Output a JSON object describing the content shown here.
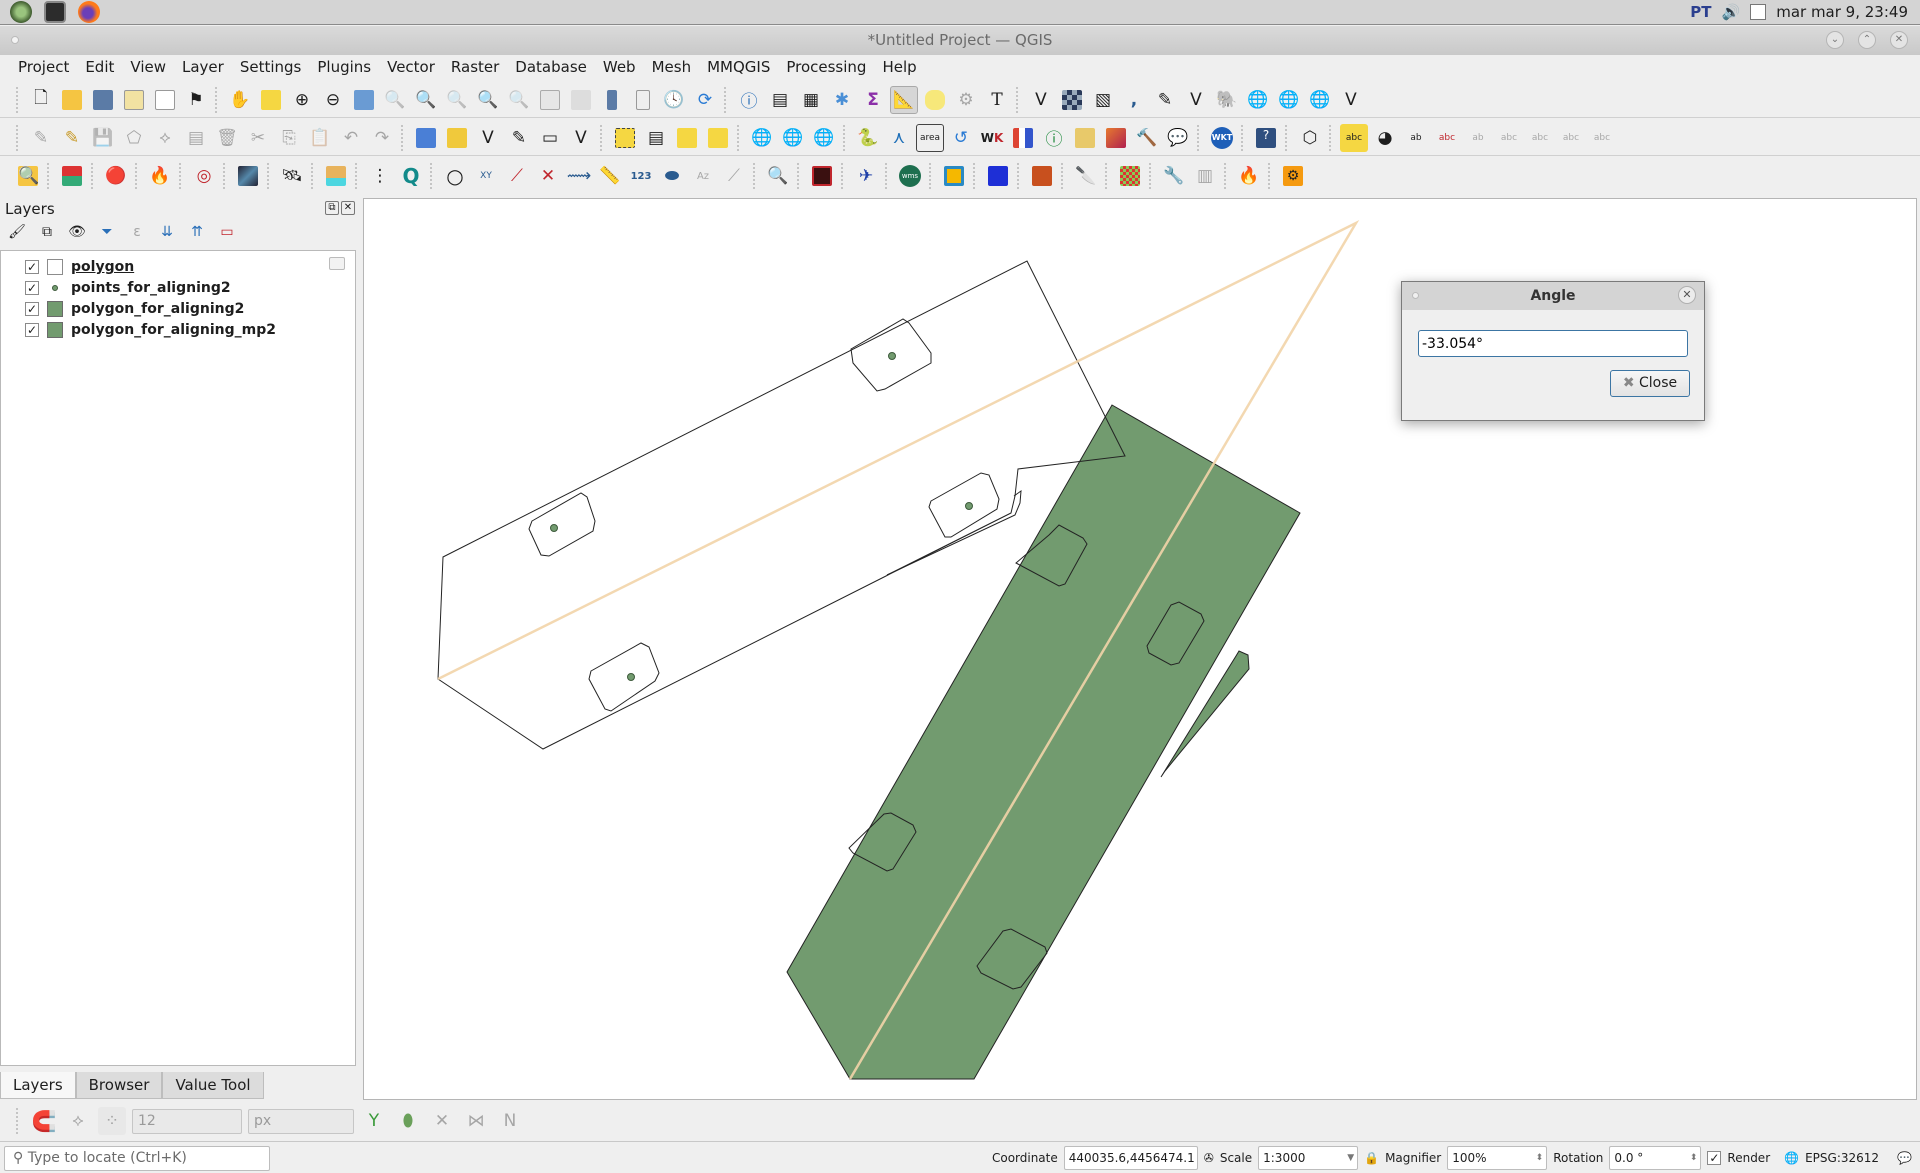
{
  "system_bar": {
    "launchers": [
      "system-launcher",
      "terminal",
      "firefox"
    ],
    "keyboard_layout": "PT",
    "clock": "mar mar  9, 23:49"
  },
  "window": {
    "title": "*Untitled Project — QGIS"
  },
  "menu": [
    "Project",
    "Edit",
    "View",
    "Layer",
    "Settings",
    "Plugins",
    "Vector",
    "Raster",
    "Database",
    "Web",
    "Mesh",
    "MMQGIS",
    "Processing",
    "Help"
  ],
  "layers_panel": {
    "title": "Layers",
    "layers": [
      {
        "name": "polygon",
        "checked": true,
        "symbol": "polygon-empty",
        "active": true
      },
      {
        "name": "points_for_aligning2",
        "checked": true,
        "symbol": "point-green"
      },
      {
        "name": "polygon_for_aligning2",
        "checked": true,
        "symbol": "polygon-green"
      },
      {
        "name": "polygon_for_aligning_mp2",
        "checked": true,
        "symbol": "polygon-green"
      }
    ],
    "tabs": [
      {
        "label": "Layers",
        "active": true
      },
      {
        "label": "Browser",
        "active": false
      },
      {
        "label": "Value Tool",
        "active": false
      }
    ]
  },
  "colors": {
    "polygon_fill": "#729b6f",
    "polygon_stroke": "#232323",
    "measure_line": "#f2d4a8",
    "point_fill": "#729b6f"
  },
  "snapping": {
    "tolerance": "12",
    "units": "px"
  },
  "angle_dialog": {
    "title": "Angle",
    "value": "-33.054°",
    "close_label": "Close"
  },
  "status_bar": {
    "locator_placeholder": "Type to locate (Ctrl+K)",
    "coordinate_label": "Coordinate",
    "coordinate": "440035.6,4456474.1",
    "scale_label": "Scale",
    "scale": "1:3000",
    "magnifier_label": "Magnifier",
    "magnifier": "100%",
    "rotation_label": "Rotation",
    "rotation": "0.0 °",
    "render_label": "Render",
    "render_checked": true,
    "crs": "EPSG:32612"
  }
}
